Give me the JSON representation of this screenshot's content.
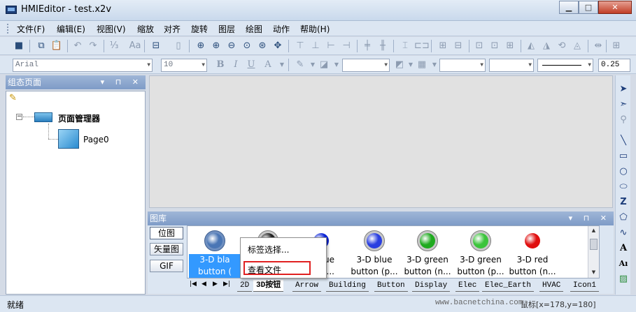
{
  "window": {
    "title": "HMIEditor - test.x2v",
    "minimize": "▁",
    "maximize": "□",
    "close": "✕"
  },
  "menu": [
    "文件(F)",
    "编辑(E)",
    "视图(V)",
    "缩放",
    "对齐",
    "旋转",
    "图层",
    "绘图",
    "动作",
    "帮助(H)"
  ],
  "format": {
    "font": "Arial",
    "size": "10",
    "bold": "B",
    "italic": "I",
    "underline": "U",
    "text_color": "A",
    "line_width": "0.25"
  },
  "left_panel": {
    "title": "组态页面",
    "ctrls": "▾ ⊓ ✕",
    "root": "页面管理器",
    "child": "Page0"
  },
  "gallery": {
    "title": "图库",
    "ctrls": "▾ ⊓ ✕",
    "side_buttons": [
      "位图",
      "矢量图",
      "GIF"
    ],
    "items": [
      {
        "line1": "3-D bla",
        "line2": "button (",
        "color": "#4a76b5",
        "selected": true
      },
      {
        "line1": "",
        "line2": "",
        "color": "#222222",
        "selected": false
      },
      {
        "line1": "lue",
        "line2": "(n...",
        "color": "#0b24d6",
        "selected": false
      },
      {
        "line1": "3-D blue",
        "line2": "button (p...",
        "color": "#2a3fe0",
        "selected": false
      },
      {
        "line1": "3-D green",
        "line2": "button (n...",
        "color": "#1faa1f",
        "selected": false
      },
      {
        "line1": "3-D green",
        "line2": "button (p...",
        "color": "#3bc43b",
        "selected": false
      },
      {
        "line1": "3-D red",
        "line2": "button (n...",
        "color": "#e00f0f",
        "selected": false
      }
    ],
    "nav": [
      "|◀",
      "◀",
      "▶",
      "▶|"
    ],
    "tabs": [
      "2D",
      "3D按钮",
      "Arrow",
      "Building",
      "Button",
      "Display",
      "Elec",
      "Elec_Earth",
      "HVAC",
      "Icon1"
    ],
    "active_tab": "3D按钮"
  },
  "context_menu": {
    "items": [
      "标签选择...",
      "查看文件"
    ],
    "highlighted": "查看文件"
  },
  "right_tools": [
    "cursor-arrow-icon",
    "cursor-node-icon",
    "pin-icon",
    "line-icon",
    "rectangle-icon",
    "circle-icon",
    "ellipse-icon",
    "polyline-icon",
    "polygon-icon",
    "curve-icon",
    "text-icon",
    "rich-text-icon",
    "image-icon"
  ],
  "right_tools_glyphs": [
    "➤",
    "➣",
    "⚲",
    "╲",
    "▭",
    "○",
    "⬭",
    "Z",
    "⬠",
    "∿",
    "A",
    "Aı",
    "▨"
  ],
  "status": {
    "text": "就绪",
    "url": "www.bacnetchina.com",
    "mouse": "鼠标[x=178,y=180]"
  },
  "colors": {
    "accent": "#3399ff",
    "highlight_border": "#e02020",
    "panel_header": "#8ea9d0"
  }
}
